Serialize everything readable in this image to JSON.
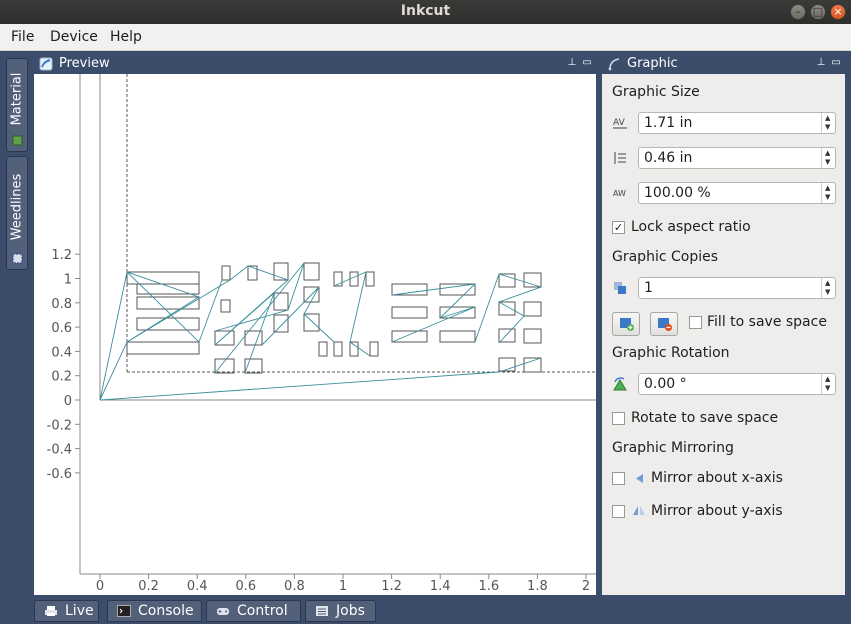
{
  "window": {
    "title": "Inkcut"
  },
  "menu": {
    "file": "File",
    "device": "Device",
    "help": "Help"
  },
  "side_tabs": {
    "material": "Material",
    "weedlines": "Weedlines"
  },
  "preview": {
    "title": "Preview",
    "x_ticks": [
      "0",
      "0.2",
      "0.4",
      "0.6",
      "0.8",
      "1",
      "1.2",
      "1.4",
      "1.6",
      "1.8",
      "2"
    ],
    "y_ticks": [
      "1.2",
      "1",
      "0.8",
      "0.6",
      "0.4",
      "0.2",
      "0",
      "-0.2",
      "-0.4",
      "-0.6"
    ]
  },
  "graphic": {
    "title": "Graphic",
    "size_label": "Graphic Size",
    "width_value": "1.71 in",
    "height_value": "0.46 in",
    "scale_value": "100.00 %",
    "lock_label": "Lock aspect ratio",
    "lock_checked": true,
    "copies_label": "Graphic Copies",
    "copies_value": "1",
    "fill_label": "Fill to save space",
    "fill_checked": false,
    "rotation_label": "Graphic Rotation",
    "rotation_value": "0.00 °",
    "rotate_save_label": "Rotate to save space",
    "rotate_save_checked": false,
    "mirroring_label": "Graphic Mirroring",
    "mirror_x_label": "Mirror about x-axis",
    "mirror_x_checked": false,
    "mirror_y_label": "Mirror about y-axis",
    "mirror_y_checked": false
  },
  "bottom_tabs": {
    "live": "Live",
    "console": "Console",
    "control": "Control",
    "jobs": "Jobs"
  },
  "colors": {
    "accent": "#3c4d6b",
    "path": "#3a8f9c",
    "panel": "#eeedeb"
  }
}
